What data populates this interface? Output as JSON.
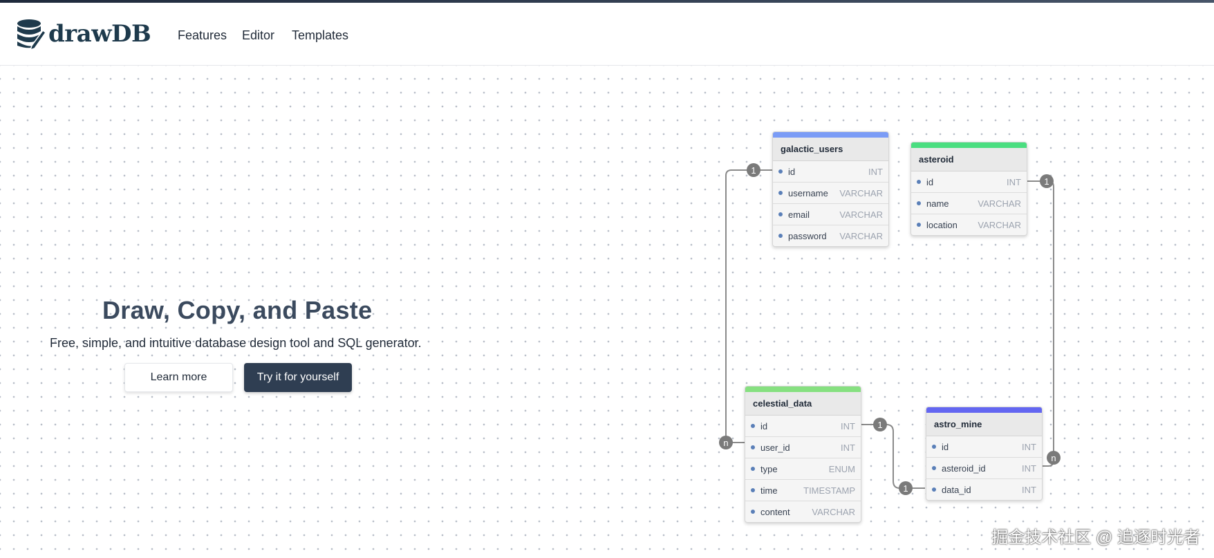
{
  "brand": {
    "name": "drawDB"
  },
  "nav": {
    "items": [
      "Features",
      "Editor",
      "Templates"
    ]
  },
  "hero": {
    "title": "Draw, Copy, and Paste",
    "subtitle": "Free, simple, and intuitive database design tool and SQL generator.",
    "learn_more": "Learn more",
    "try_it": "Try it for yourself"
  },
  "tables": [
    {
      "name": "galactic_users",
      "color": "#7b9cf6",
      "fields": [
        {
          "name": "id",
          "type": "INT"
        },
        {
          "name": "username",
          "type": "VARCHAR"
        },
        {
          "name": "email",
          "type": "VARCHAR"
        },
        {
          "name": "password",
          "type": "VARCHAR"
        }
      ]
    },
    {
      "name": "asteroid",
      "color": "#4ade80",
      "fields": [
        {
          "name": "id",
          "type": "INT"
        },
        {
          "name": "name",
          "type": "VARCHAR"
        },
        {
          "name": "location",
          "type": "VARCHAR"
        }
      ]
    },
    {
      "name": "celestial_data",
      "color": "#86e080",
      "fields": [
        {
          "name": "id",
          "type": "INT"
        },
        {
          "name": "user_id",
          "type": "INT"
        },
        {
          "name": "type",
          "type": "ENUM"
        },
        {
          "name": "time",
          "type": "TIMESTAMP"
        },
        {
          "name": "content",
          "type": "VARCHAR"
        }
      ]
    },
    {
      "name": "astro_mine",
      "color": "#6366f1",
      "fields": [
        {
          "name": "id",
          "type": "INT"
        },
        {
          "name": "asteroid_id",
          "type": "INT"
        },
        {
          "name": "data_id",
          "type": "INT"
        }
      ]
    }
  ],
  "cardinality": {
    "one": "1",
    "many": "n"
  },
  "watermark": "掘金技术社区 @ 追逐时光者"
}
